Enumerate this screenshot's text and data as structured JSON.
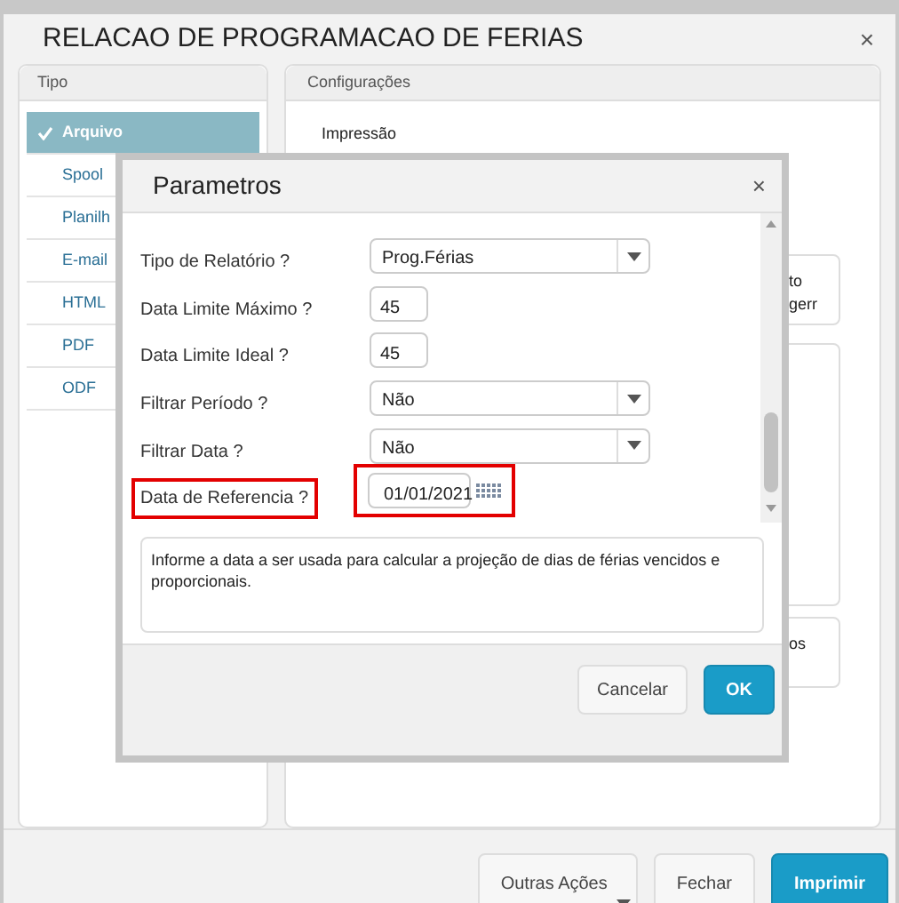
{
  "window": {
    "title": "RELACAO DE PROGRAMACAO DE FERIAS",
    "close": "×"
  },
  "tipo": {
    "heading": "Tipo",
    "items": [
      {
        "label": "Arquivo",
        "selected": true
      },
      {
        "label": "Spool",
        "selected": false
      },
      {
        "label": "Planilh",
        "selected": false
      },
      {
        "label": "E-mail",
        "selected": false
      },
      {
        "label": "HTML",
        "selected": false
      },
      {
        "label": "PDF",
        "selected": false
      },
      {
        "label": "ODF",
        "selected": false
      }
    ]
  },
  "configuracoes": {
    "heading": "Configurações",
    "impressao_label": "Impressão",
    "card_texts": [
      "to",
      "gerr"
    ],
    "lower_card_text": "os"
  },
  "dialog": {
    "title": "Parametros",
    "close": "×",
    "fields": [
      {
        "kind": "select",
        "label": "Tipo de Relatório ?",
        "value": "Prog.Férias",
        "highlighted": false
      },
      {
        "kind": "number",
        "label": "Data Limite Máximo ?",
        "value": "45",
        "highlighted": false
      },
      {
        "kind": "number",
        "label": "Data Limite Ideal ?",
        "value": "45",
        "highlighted": false
      },
      {
        "kind": "select",
        "label": "Filtrar Período ?",
        "value": "Não",
        "highlighted": false
      },
      {
        "kind": "select",
        "label": "Filtrar Data ?",
        "value": "Não",
        "highlighted": false
      },
      {
        "kind": "date",
        "label": "Data de Referencia ?",
        "value": "01/01/2021",
        "highlighted": true
      }
    ],
    "help": "Informe a data a ser usada para calcular a projeção de dias de férias vencidos e proporcionais.",
    "buttons": [
      {
        "label": "Cancelar",
        "primary": false
      },
      {
        "label": "OK",
        "primary": true
      }
    ]
  },
  "footer": {
    "buttons": [
      {
        "label": "Outras Ações",
        "kind": "menu"
      },
      {
        "label": "Fechar",
        "kind": "plain"
      },
      {
        "label": "Imprimir",
        "kind": "primary"
      }
    ]
  }
}
